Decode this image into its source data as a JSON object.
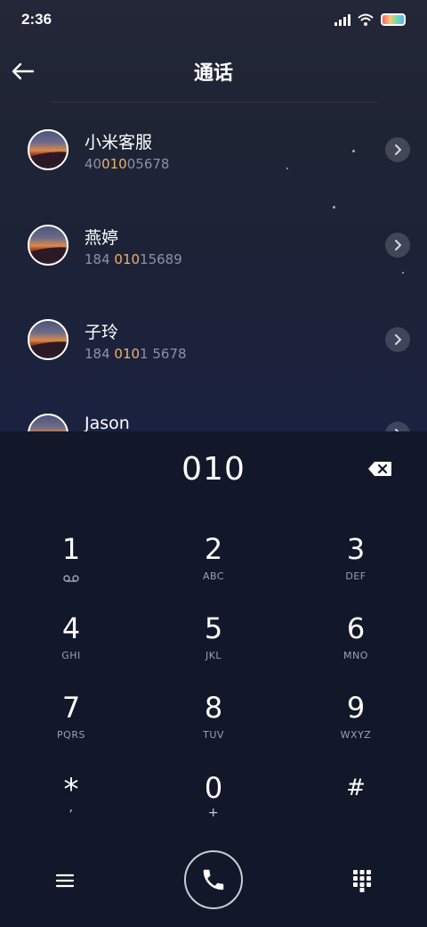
{
  "status": {
    "time": "2:36"
  },
  "header": {
    "title": "通话"
  },
  "contacts": [
    {
      "name": "小米客服",
      "num_pre": "40",
      "num_hl": "010",
      "num_post": "05678"
    },
    {
      "name": "燕婷",
      "num_pre": "184 ",
      "num_hl": "010",
      "num_post": "15689"
    },
    {
      "name": "子玲",
      "num_pre": "184 ",
      "num_hl": "010",
      "num_post": "1 5678"
    },
    {
      "name": "Jason",
      "num_pre": "",
      "num_hl": "",
      "num_post": ""
    }
  ],
  "dialer": {
    "typed": "010",
    "keys": [
      {
        "digit": "1",
        "letters": "voicemail-icon"
      },
      {
        "digit": "2",
        "letters": "ABC"
      },
      {
        "digit": "3",
        "letters": "DEF"
      },
      {
        "digit": "4",
        "letters": "GHI"
      },
      {
        "digit": "5",
        "letters": "JKL"
      },
      {
        "digit": "6",
        "letters": "MNO"
      },
      {
        "digit": "7",
        "letters": "PQRS"
      },
      {
        "digit": "8",
        "letters": "TUV"
      },
      {
        "digit": "9",
        "letters": "WXYZ"
      },
      {
        "digit": "*",
        "letters": ","
      },
      {
        "digit": "0",
        "letters": "+"
      },
      {
        "digit": "#",
        "letters": ""
      }
    ]
  },
  "icons": {
    "back": "back-arrow-icon",
    "chevron": "chevron-right-icon",
    "backspace": "backspace-icon",
    "menu": "menu-icon",
    "call": "phone-icon",
    "keypad": "keypad-icon"
  },
  "colors": {
    "highlight": "#f0b26a",
    "accent_bg": "#12172a"
  }
}
